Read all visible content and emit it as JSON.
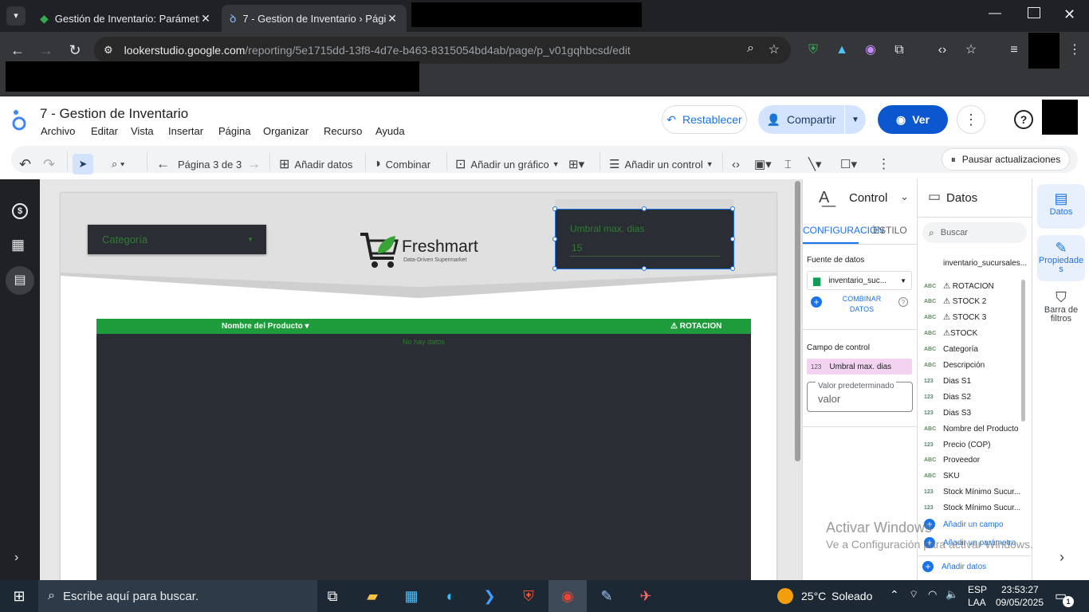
{
  "browser": {
    "tabs": [
      {
        "title": "Gestión de Inventario: Parámetr",
        "active": false
      },
      {
        "title": "7 - Gestion de Inventario › Págin",
        "active": true
      }
    ],
    "url_host": "lookerstudio.google.com",
    "url_path": "/reporting/5e1715dd-13f8-4d7e-b463-8315054bd4ab/page/p_v01gqhbcsd/edit"
  },
  "app": {
    "title": "7 - Gestion de Inventario",
    "menu": [
      "Archivo",
      "Editar",
      "Vista",
      "Insertar",
      "Página",
      "Organizar",
      "Recurso",
      "Ayuda"
    ],
    "buttons": {
      "reset": "Restablecer",
      "share": "Compartir",
      "view": "Ver"
    },
    "toolbar": {
      "page_indicator": "Página 3 de 3",
      "add_data": "Añadir datos",
      "blend": "Combinar",
      "add_chart": "Añadir un gráfico",
      "add_control": "Añadir un control",
      "pause_updates": "Pausar actualizaciones"
    }
  },
  "report": {
    "category_dropdown": "Categoría",
    "logo_name": "Freshmart",
    "logo_tagline": "Data-Driven Supermarket",
    "threshold_label": "Umbral max. dias",
    "threshold_value": "15",
    "table": {
      "col_product": "Nombre del Producto ▾",
      "col_rotation": "⚠ ROTACION",
      "empty_text": "No hay datos"
    }
  },
  "properties": {
    "title": "Control",
    "tab_config": "CONFIGURACIÓN",
    "tab_style": "ESTILO",
    "data_source_label": "Fuente de datos",
    "data_source": "inventario_suc...",
    "blend_data": "COMBINAR DATOS",
    "control_field_label": "Campo de control",
    "control_field_type": "123",
    "control_field": "Umbral max. dias",
    "default_value_label": "Valor predeterminado",
    "default_value_placeholder": "valor"
  },
  "data_panel": {
    "title": "Datos",
    "search_placeholder": "Buscar",
    "source_name": "inventario_sucursales...",
    "fields": [
      {
        "type": "ABC",
        "name": "⚠ ROTACION"
      },
      {
        "type": "ABC",
        "name": "⚠ STOCK 2"
      },
      {
        "type": "ABC",
        "name": "⚠ STOCK 3"
      },
      {
        "type": "ABC",
        "name": "⚠STOCK"
      },
      {
        "type": "ABC",
        "name": "Categoría"
      },
      {
        "type": "ABC",
        "name": "Descripción"
      },
      {
        "type": "123",
        "name": "Dias S1"
      },
      {
        "type": "123",
        "name": "Dias S2"
      },
      {
        "type": "123",
        "name": "Dias S3"
      },
      {
        "type": "ABC",
        "name": "Nombre del Producto"
      },
      {
        "type": "123",
        "name": "Precio (COP)"
      },
      {
        "type": "ABC",
        "name": "Proveedor"
      },
      {
        "type": "ABC",
        "name": "SKU"
      },
      {
        "type": "123",
        "name": "Stock Mínimo Sucur..."
      },
      {
        "type": "123",
        "name": "Stock Mínimo Sucur..."
      }
    ],
    "add_field": "Añadir un campo",
    "add_param": "Añadir un parámetro",
    "add_data": "Añadir datos"
  },
  "side_rail": {
    "data": "Datos",
    "properties": "Propiedades",
    "filters": "Barra de filtros"
  },
  "watermark": {
    "line1": "Activar Windows",
    "line2": "Ve a Configuración para activar Windows."
  },
  "taskbar": {
    "search_placeholder": "Escribe aquí para buscar.",
    "weather_temp": "25°C",
    "weather_text": "Soleado",
    "lang1": "ESP",
    "lang2": "LAA",
    "time": "23:53:27",
    "date": "09/05/2025",
    "notif_count": "1"
  },
  "colors": {
    "accent_blue": "#1a73e8",
    "table_green": "#1e9b3b",
    "dark_panel": "#2a2d33"
  }
}
